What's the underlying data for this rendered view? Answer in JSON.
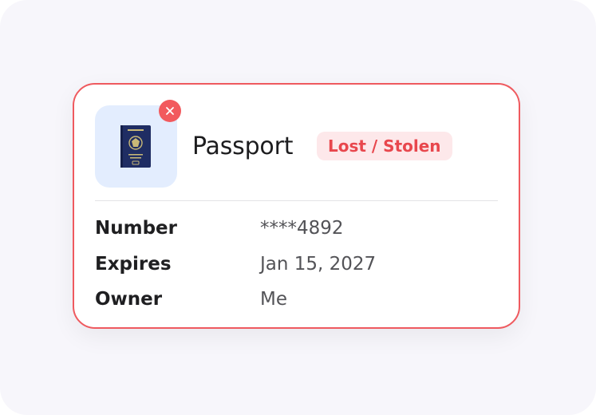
{
  "document": {
    "title": "Passport",
    "status": "Lost / Stolen",
    "thumbnail_icon": "passport-icon",
    "remove_icon": "close-icon",
    "fields": [
      {
        "label": "Number",
        "value": "****4892"
      },
      {
        "label": "Expires",
        "value": "Jan 15, 2027"
      },
      {
        "label": "Owner",
        "value": "Me"
      }
    ]
  },
  "colors": {
    "accent_red": "#ef5a5f",
    "badge_bg": "#fde8ea",
    "thumb_bg": "#e3edfe",
    "passport_cover": "#1f2d63"
  }
}
